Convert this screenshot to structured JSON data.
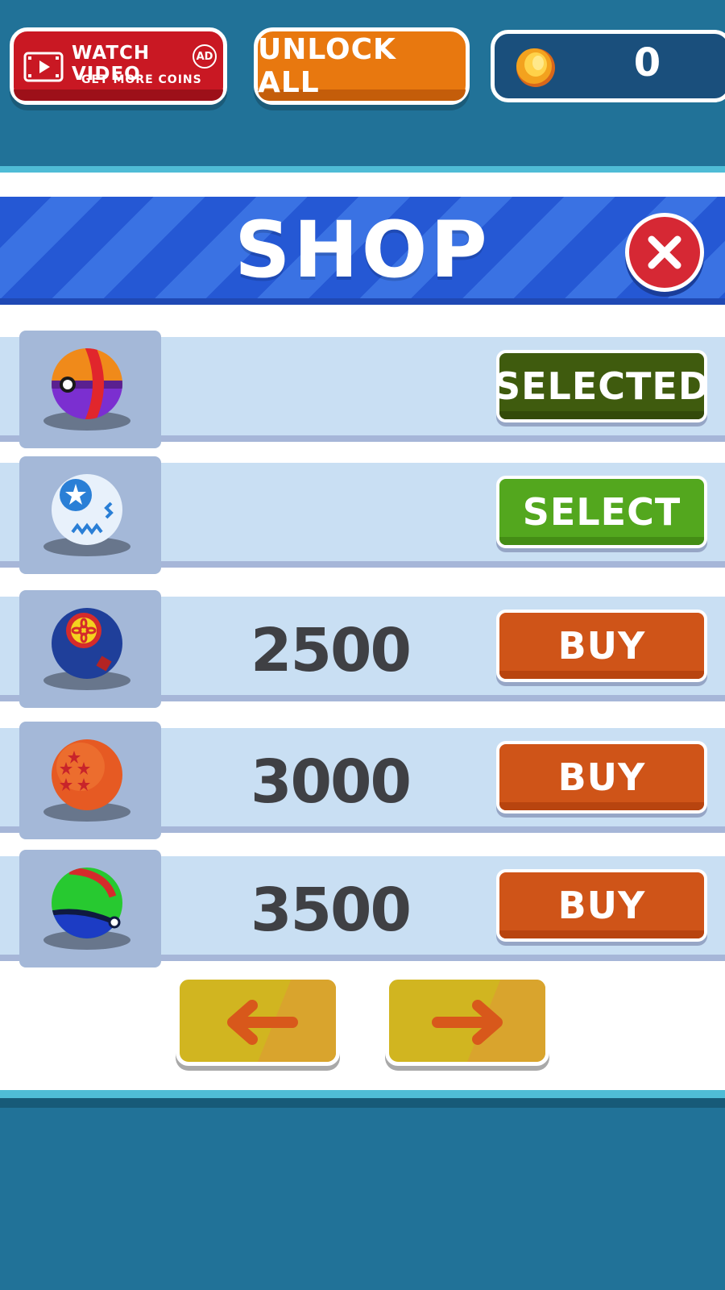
{
  "topbar": {
    "watch_video": {
      "title": "WATCH VIDEO",
      "badge": "AD",
      "subtitle": "GET MORE COINS",
      "icon": "film-play-icon"
    },
    "unlock_all": "UNLOCK ALL",
    "coins": {
      "icon": "coin-icon",
      "count": "0"
    }
  },
  "shop": {
    "title": "SHOP",
    "close_icon": "close-x-icon",
    "items": [
      {
        "ball": "orange-purple-ball",
        "price": "",
        "action": "SELECTED",
        "state": "selected"
      },
      {
        "ball": "white-blue-star-ball",
        "price": "",
        "action": "SELECT",
        "state": "owned"
      },
      {
        "ball": "blue-flower-ball",
        "price": "2500",
        "action": "BUY",
        "state": "locked"
      },
      {
        "ball": "orange-star-ball",
        "price": "3000",
        "action": "BUY",
        "state": "locked"
      },
      {
        "ball": "green-blue-ball",
        "price": "3500",
        "action": "BUY",
        "state": "locked"
      }
    ],
    "nav": {
      "prev_icon": "arrow-left-icon",
      "next_icon": "arrow-right-icon"
    }
  },
  "colors": {
    "background": "#217298",
    "banner": "#2558d4",
    "selected_button": "#3f5b0e",
    "select_button": "#53a71e",
    "buy_button": "#cf5418",
    "watch_button": "#c91823",
    "unlock_button": "#e8780f",
    "nav_button": "#d1b520"
  }
}
